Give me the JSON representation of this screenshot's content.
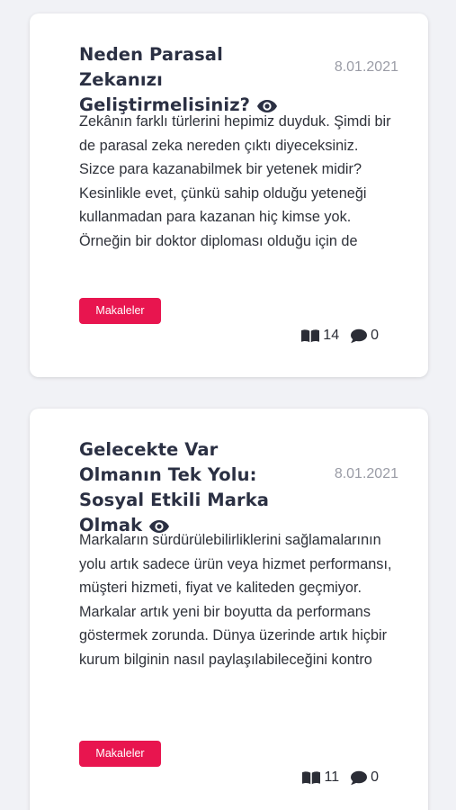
{
  "articles": [
    {
      "title": "Neden Parasal Zekanızı Geliştirmelisiniz?",
      "date": "8.01.2021",
      "excerpt": "Zekânın farklı türlerini hepimiz duyduk. Şimdi bir de parasal zeka nereden çıktı diyeceksiniz. Sizce para kazanabilmek bir yetenek midir?Kesinlikle evet, çünkü sahip olduğu yeteneği kullanmadan para kazanan hiç kimse yok. Örneğin bir doktor diploması olduğu için de",
      "category": "Makaleler",
      "reads": "14",
      "comments": "0"
    },
    {
      "title": "Gelecekte Var Olmanın Tek Yolu: Sosyal Etkili Marka Olmak",
      "date": "8.01.2021",
      "excerpt": "Markaların sürdürülebilirliklerini sağlamalarının yolu artık sadece ürün veya hizmet performansı, müşteri hizmeti, fiyat ve kaliteden geçmiyor. Markalar artık yeni bir boyutta da performans göstermek zorunda. Dünya üzerinde artık hiçbir kurum bilginin nasıl paylaşılabileceğini kontro",
      "category": "Makaleler",
      "reads": "11",
      "comments": "0"
    }
  ],
  "icons": {
    "views": "eye-icon",
    "reads": "book-open-icon",
    "comments": "comment-icon"
  },
  "colors": {
    "accent": "#e8154f",
    "title": "#2b3043",
    "date": "#9a9ca6",
    "background": "#f1f2f6"
  }
}
